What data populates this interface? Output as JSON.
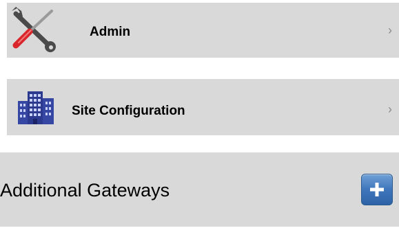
{
  "menu": {
    "admin": {
      "label": "Admin",
      "icon": "tools-icon",
      "chevron": "›"
    },
    "site_configuration": {
      "label": "Site Configuration",
      "icon": "building-icon",
      "chevron": "›"
    }
  },
  "gateways": {
    "label": "Additional Gateways",
    "add_icon": "plus-icon"
  },
  "colors": {
    "row_background": "#d9d9d9",
    "chevron": "#8a8a8a",
    "add_button": "#3f76bb",
    "building": "#2b3a8f",
    "screwdriver_handle": "#d9262a"
  }
}
